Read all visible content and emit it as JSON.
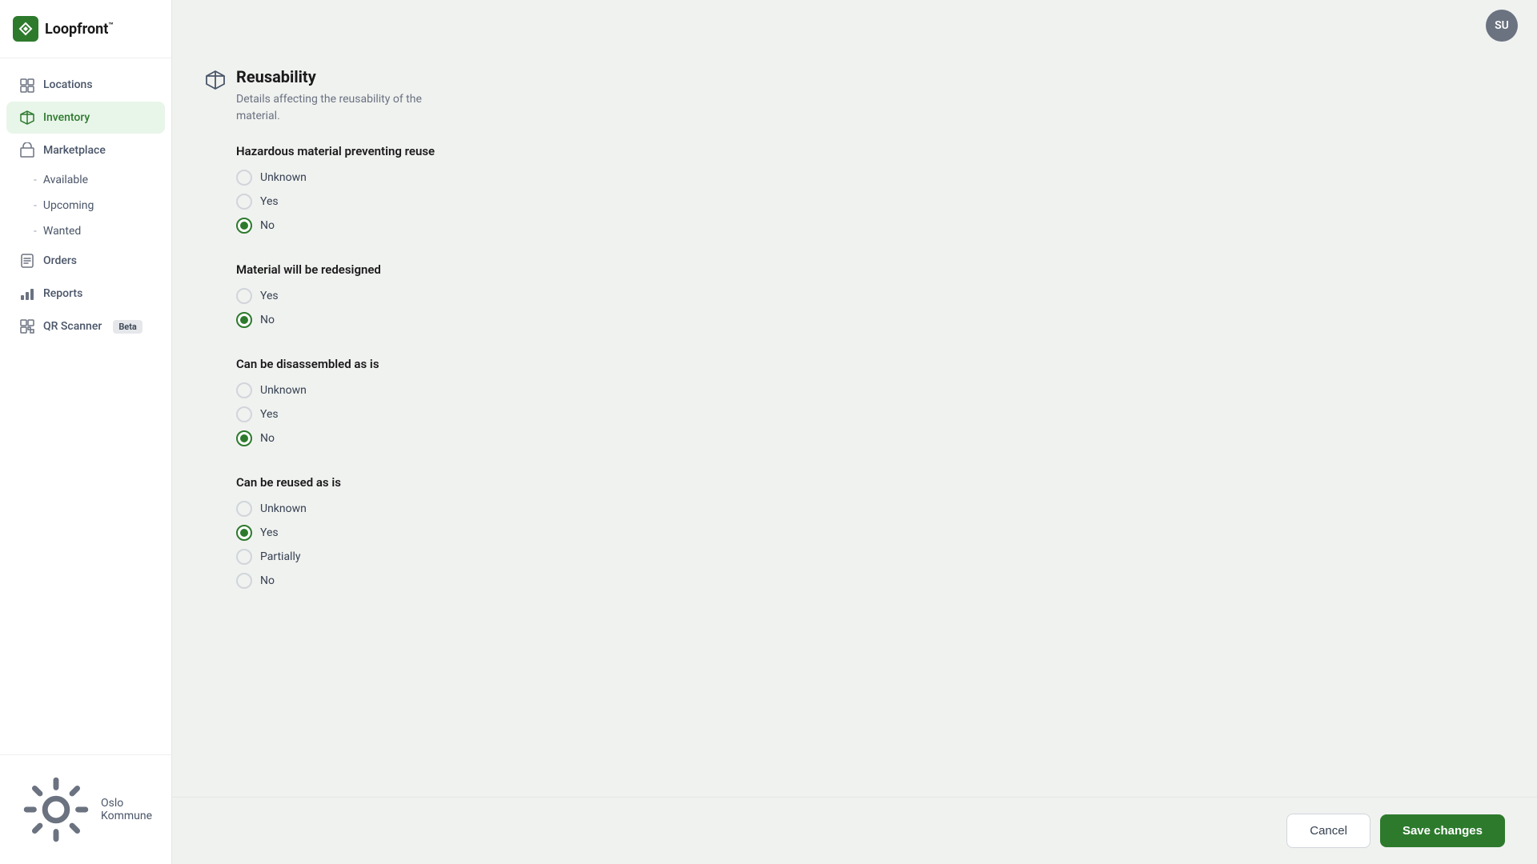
{
  "app": {
    "name": "Loopfront",
    "trademark": "™",
    "avatar_initials": "SU"
  },
  "sidebar": {
    "nav_items": [
      {
        "id": "locations",
        "label": "Locations",
        "icon": "location-icon"
      },
      {
        "id": "inventory",
        "label": "Inventory",
        "icon": "inventory-icon",
        "active": true
      },
      {
        "id": "marketplace",
        "label": "Marketplace",
        "icon": "marketplace-icon"
      }
    ],
    "sub_items": [
      {
        "id": "available",
        "label": "Available"
      },
      {
        "id": "upcoming",
        "label": "Upcoming"
      },
      {
        "id": "wanted",
        "label": "Wanted"
      }
    ],
    "bottom_items": [
      {
        "id": "orders",
        "label": "Orders",
        "icon": "orders-icon"
      },
      {
        "id": "reports",
        "label": "Reports",
        "icon": "reports-icon"
      },
      {
        "id": "qr-scanner",
        "label": "QR Scanner",
        "icon": "qr-icon",
        "badge": "Beta"
      }
    ],
    "footer": {
      "org_name": "Oslo Kommune",
      "icon": "settings-icon"
    }
  },
  "main": {
    "section": {
      "title": "Reusability",
      "description": "Details affecting the reusability of the\nmaterial."
    },
    "questions": [
      {
        "id": "hazardous",
        "label": "Hazardous material preventing reuse",
        "options": [
          {
            "value": "unknown",
            "label": "Unknown",
            "checked": false
          },
          {
            "value": "yes",
            "label": "Yes",
            "checked": false
          },
          {
            "value": "no",
            "label": "No",
            "checked": true
          }
        ]
      },
      {
        "id": "redesigned",
        "label": "Material will be redesigned",
        "options": [
          {
            "value": "yes",
            "label": "Yes",
            "checked": false
          },
          {
            "value": "no",
            "label": "No",
            "checked": true
          }
        ]
      },
      {
        "id": "disassembled",
        "label": "Can be disassembled as is",
        "options": [
          {
            "value": "unknown",
            "label": "Unknown",
            "checked": false
          },
          {
            "value": "yes",
            "label": "Yes",
            "checked": false
          },
          {
            "value": "no",
            "label": "No",
            "checked": true
          }
        ]
      },
      {
        "id": "reused",
        "label": "Can be reused as is",
        "options": [
          {
            "value": "unknown",
            "label": "Unknown",
            "checked": false
          },
          {
            "value": "yes",
            "label": "Yes",
            "checked": true
          },
          {
            "value": "partially",
            "label": "Partially",
            "checked": false
          },
          {
            "value": "no",
            "label": "No",
            "checked": false
          }
        ]
      }
    ],
    "buttons": {
      "cancel": "Cancel",
      "save": "Save changes"
    }
  }
}
